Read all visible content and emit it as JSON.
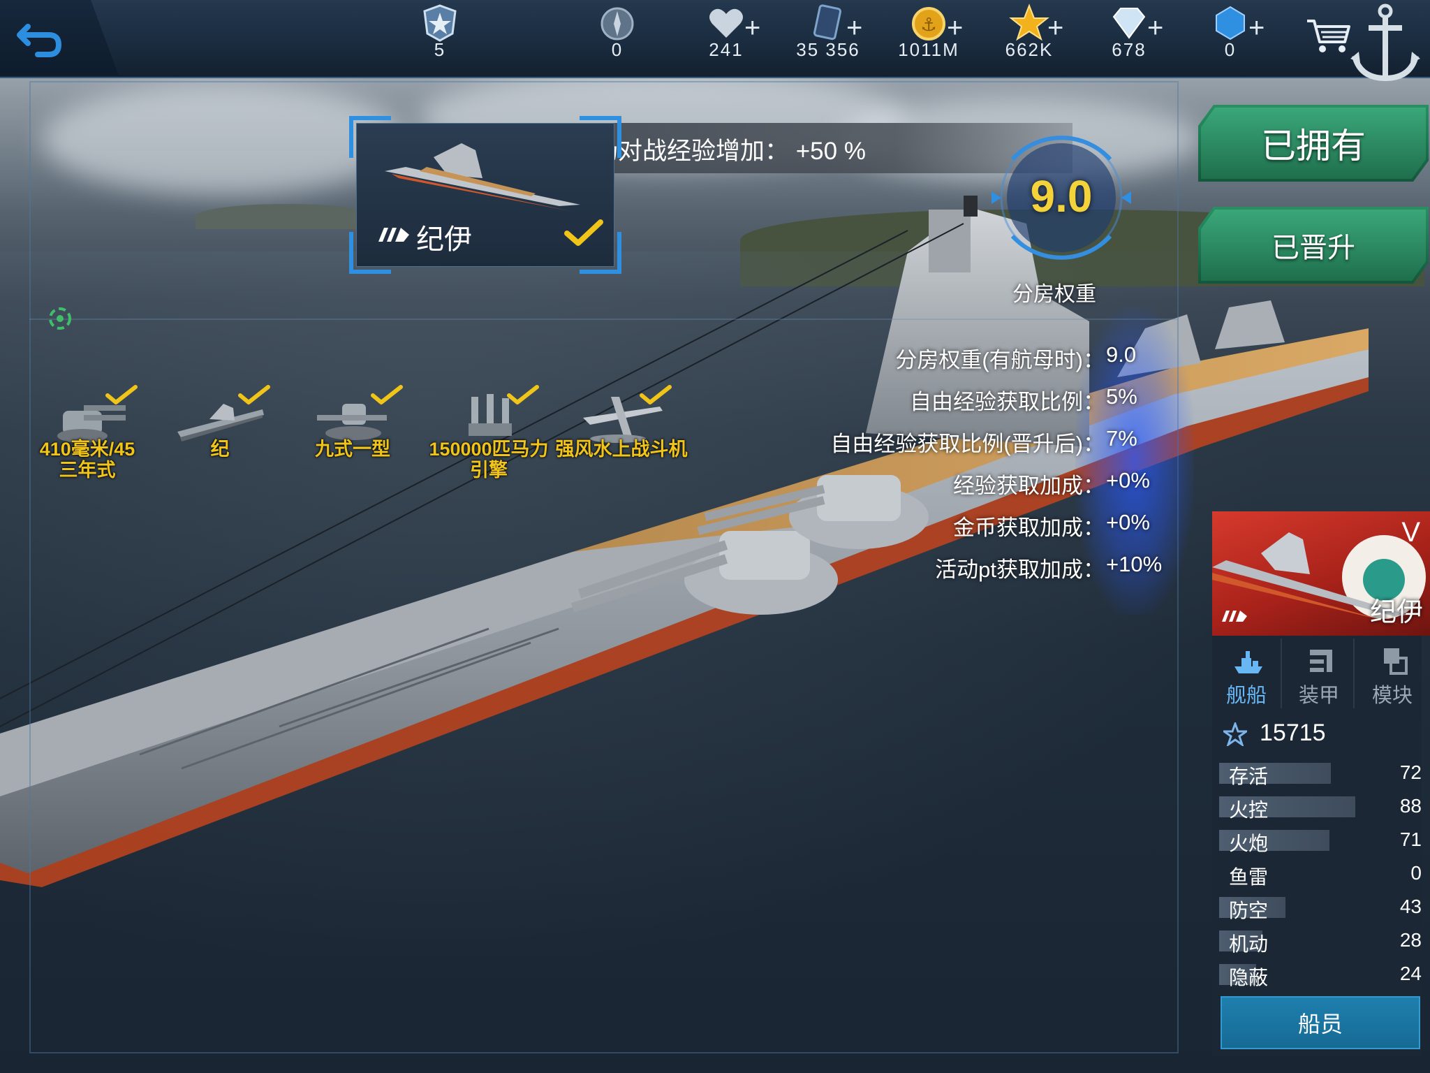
{
  "topbar": {
    "resources": [
      {
        "icon": "rank-badge-icon",
        "value": "5",
        "has_plus": false
      },
      {
        "icon": "compass-medal-icon",
        "value": "0",
        "has_plus": false
      },
      {
        "icon": "heart-icon",
        "value": "241",
        "has_plus": true
      },
      {
        "icon": "card-icon",
        "value": "35 356",
        "has_plus": true
      },
      {
        "icon": "gold-coin-icon",
        "value": "1011M",
        "has_plus": true
      },
      {
        "icon": "star-icon",
        "value": "662K",
        "has_plus": true
      },
      {
        "icon": "diamond-icon",
        "value": "678",
        "has_plus": true
      },
      {
        "icon": "blue-gem-icon",
        "value": "0",
        "has_plus": true
      }
    ],
    "plus_symbol": "+"
  },
  "card": {
    "ship_name": "纪伊",
    "banner": "竞技场对战经验增加：  +50 %"
  },
  "rating": {
    "value": "9.0",
    "label": "分房权重"
  },
  "stats": [
    {
      "label": "分房权重(有航母时)：",
      "value": "9.0"
    },
    {
      "label": "自由经验获取比例：",
      "value": "5%"
    },
    {
      "label": "自由经验获取比例(晋升后)：",
      "value": "7%"
    },
    {
      "label": "经验获取加成：",
      "value": "+0%"
    },
    {
      "label": "金币获取加成：",
      "value": "+0%"
    },
    {
      "label": "活动pt获取加成：",
      "value": "+10%"
    }
  ],
  "equipment": [
    {
      "name": "410毫米/45\n三年式",
      "icon": "turret-icon"
    },
    {
      "name": "纪",
      "icon": "warship-icon"
    },
    {
      "name": "九式一型",
      "icon": "fire-control-icon"
    },
    {
      "name": "150000匹马力\n引擎",
      "icon": "engine-icon"
    },
    {
      "name": "强风水上战斗机",
      "icon": "seaplane-icon"
    }
  ],
  "buttons": {
    "owned": "已拥有",
    "promoted": "已晋升",
    "crew": "船员"
  },
  "panel": {
    "tier": "V",
    "ship_name": "纪伊",
    "tabs": [
      {
        "label": "舰船",
        "icon": "ship-tab-icon",
        "active": true
      },
      {
        "label": "装甲",
        "icon": "armor-tab-icon",
        "active": false
      },
      {
        "label": "模块",
        "icon": "module-tab-icon",
        "active": false
      }
    ],
    "score": "15715",
    "attributes": [
      {
        "name": "存活",
        "value": "72",
        "fill": 0.72
      },
      {
        "name": "火控",
        "value": "88",
        "fill": 0.88
      },
      {
        "name": "火炮",
        "value": "71",
        "fill": 0.71
      },
      {
        "name": "鱼雷",
        "value": "0",
        "fill": 0.0
      },
      {
        "name": "防空",
        "value": "43",
        "fill": 0.43
      },
      {
        "name": "机动",
        "value": "28",
        "fill": 0.28
      },
      {
        "name": "隐蔽",
        "value": "24",
        "fill": 0.24
      }
    ]
  },
  "colors": {
    "accent_blue": "#2f8fe0",
    "gold": "#f0c419",
    "green_button": "#1f7a53",
    "flag_red": "#c8281f"
  }
}
